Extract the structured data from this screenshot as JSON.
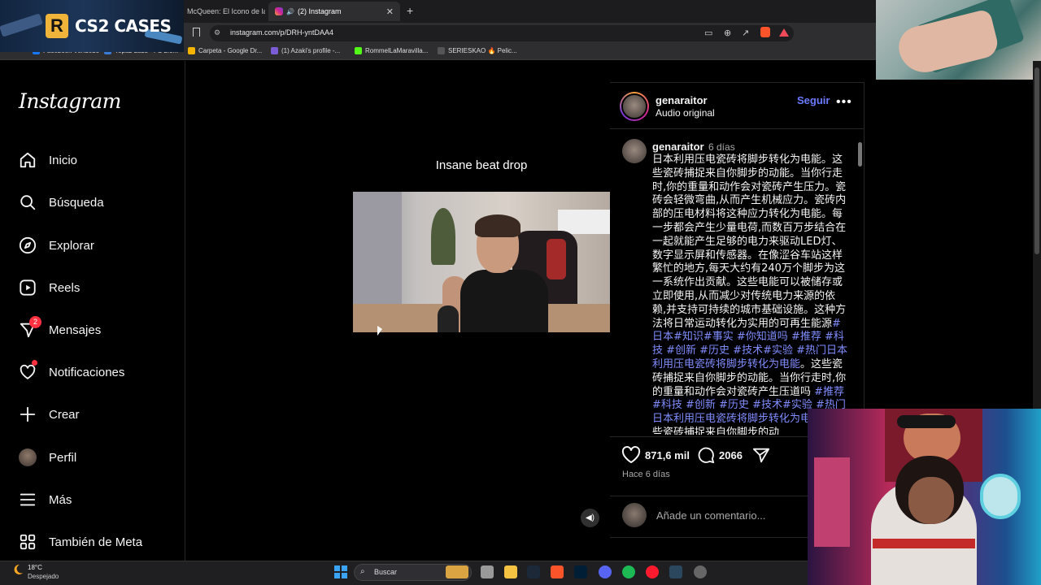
{
  "browser": {
    "tabs": [
      {
        "label": "McQueen: El Icono de la M"
      },
      {
        "label": "(2) Instagram"
      }
    ],
    "url": "instagram.com/p/DRH-yntDAA4",
    "bookmarks": [
      {
        "label": "Facebook Vendedo"
      },
      {
        "label": "Topaz Labs - FS 2.0..."
      },
      {
        "label": "Carpeta - Google Dr..."
      },
      {
        "label": "(1) Azaki's profile -..."
      },
      {
        "label": "RommelLaMaravilla..."
      },
      {
        "label": "SERIESKAO 🔥 Pelic..."
      }
    ],
    "banner_text": "CS2 CASES",
    "banner_logo_letter": "R"
  },
  "sidebar": {
    "logo": "Instagram",
    "items": [
      {
        "label": "Inicio",
        "icon": "home-icon"
      },
      {
        "label": "Búsqueda",
        "icon": "search-icon"
      },
      {
        "label": "Explorar",
        "icon": "compass-icon"
      },
      {
        "label": "Reels",
        "icon": "reels-icon"
      },
      {
        "label": "Mensajes",
        "icon": "messenger-icon",
        "badge": "2"
      },
      {
        "label": "Notificaciones",
        "icon": "heart-icon"
      },
      {
        "label": "Crear",
        "icon": "plus-icon"
      },
      {
        "label": "Perfil",
        "icon": "avatar"
      },
      {
        "label": "Más",
        "icon": "menu-icon"
      },
      {
        "label": "También de Meta",
        "icon": "meta-grid-icon"
      }
    ]
  },
  "post": {
    "video_caption": "Insane beat drop",
    "username": "genaraitor",
    "audio": "Audio original",
    "follow_label": "Seguir",
    "more_label": "•••",
    "comment": {
      "username": "genaraitor",
      "time": "6 días",
      "text_a": "日本利用压电瓷砖将脚步转化为电能。这些瓷砖捕捉来自你脚步的动能。当你行走时,你的重量和动作会对瓷砖产生压力。瓷砖会轻微弯曲,从而产生机械应力。瓷砖内部的压电材料将这种应力转化为电能。每一步都会产生少量电荷,而数百万步结合在一起就能产生足够的电力来驱动LED灯、数字显示屏和传感器。在像涩谷车站这样繁忙的地方,每天大约有240万个脚步为这一系统作出贡献。这些电能可以被储存或立即使用,从而减少对传统电力来源的依赖,并支持可持续的城市基础设施。这种方法将日常运动转化为实用的可再生能源",
      "tags_a": "#日本#知识#事实 #你知道吗 #推荐 #科技 #创新 #历史 #技术#实验 #热门日本利用压电瓷砖将脚步转化为电能",
      "text_b": "。这些瓷砖捕捉来自你脚步的动能。当你行走时,你的重量和动作会对瓷砖产生压道吗 ",
      "tags_b": "#推荐 #科技 #创新 #历史 #技术#实验 #热门日本利用压电瓷砖将脚步转化为电能",
      "text_c": "。这些瓷砖捕捉来自你脚步的动"
    },
    "likes": "871,6 mil",
    "comments": "2066",
    "posted_ago": "Hace 6 días",
    "add_comment_placeholder": "Añade un comentario..."
  },
  "taskbar": {
    "temperature": "18°C",
    "weather": "Despejado",
    "search_label": "Buscar"
  },
  "colors": {
    "accent_link": "#6a7bff",
    "badge": "#ff3040",
    "background": "#000000"
  }
}
